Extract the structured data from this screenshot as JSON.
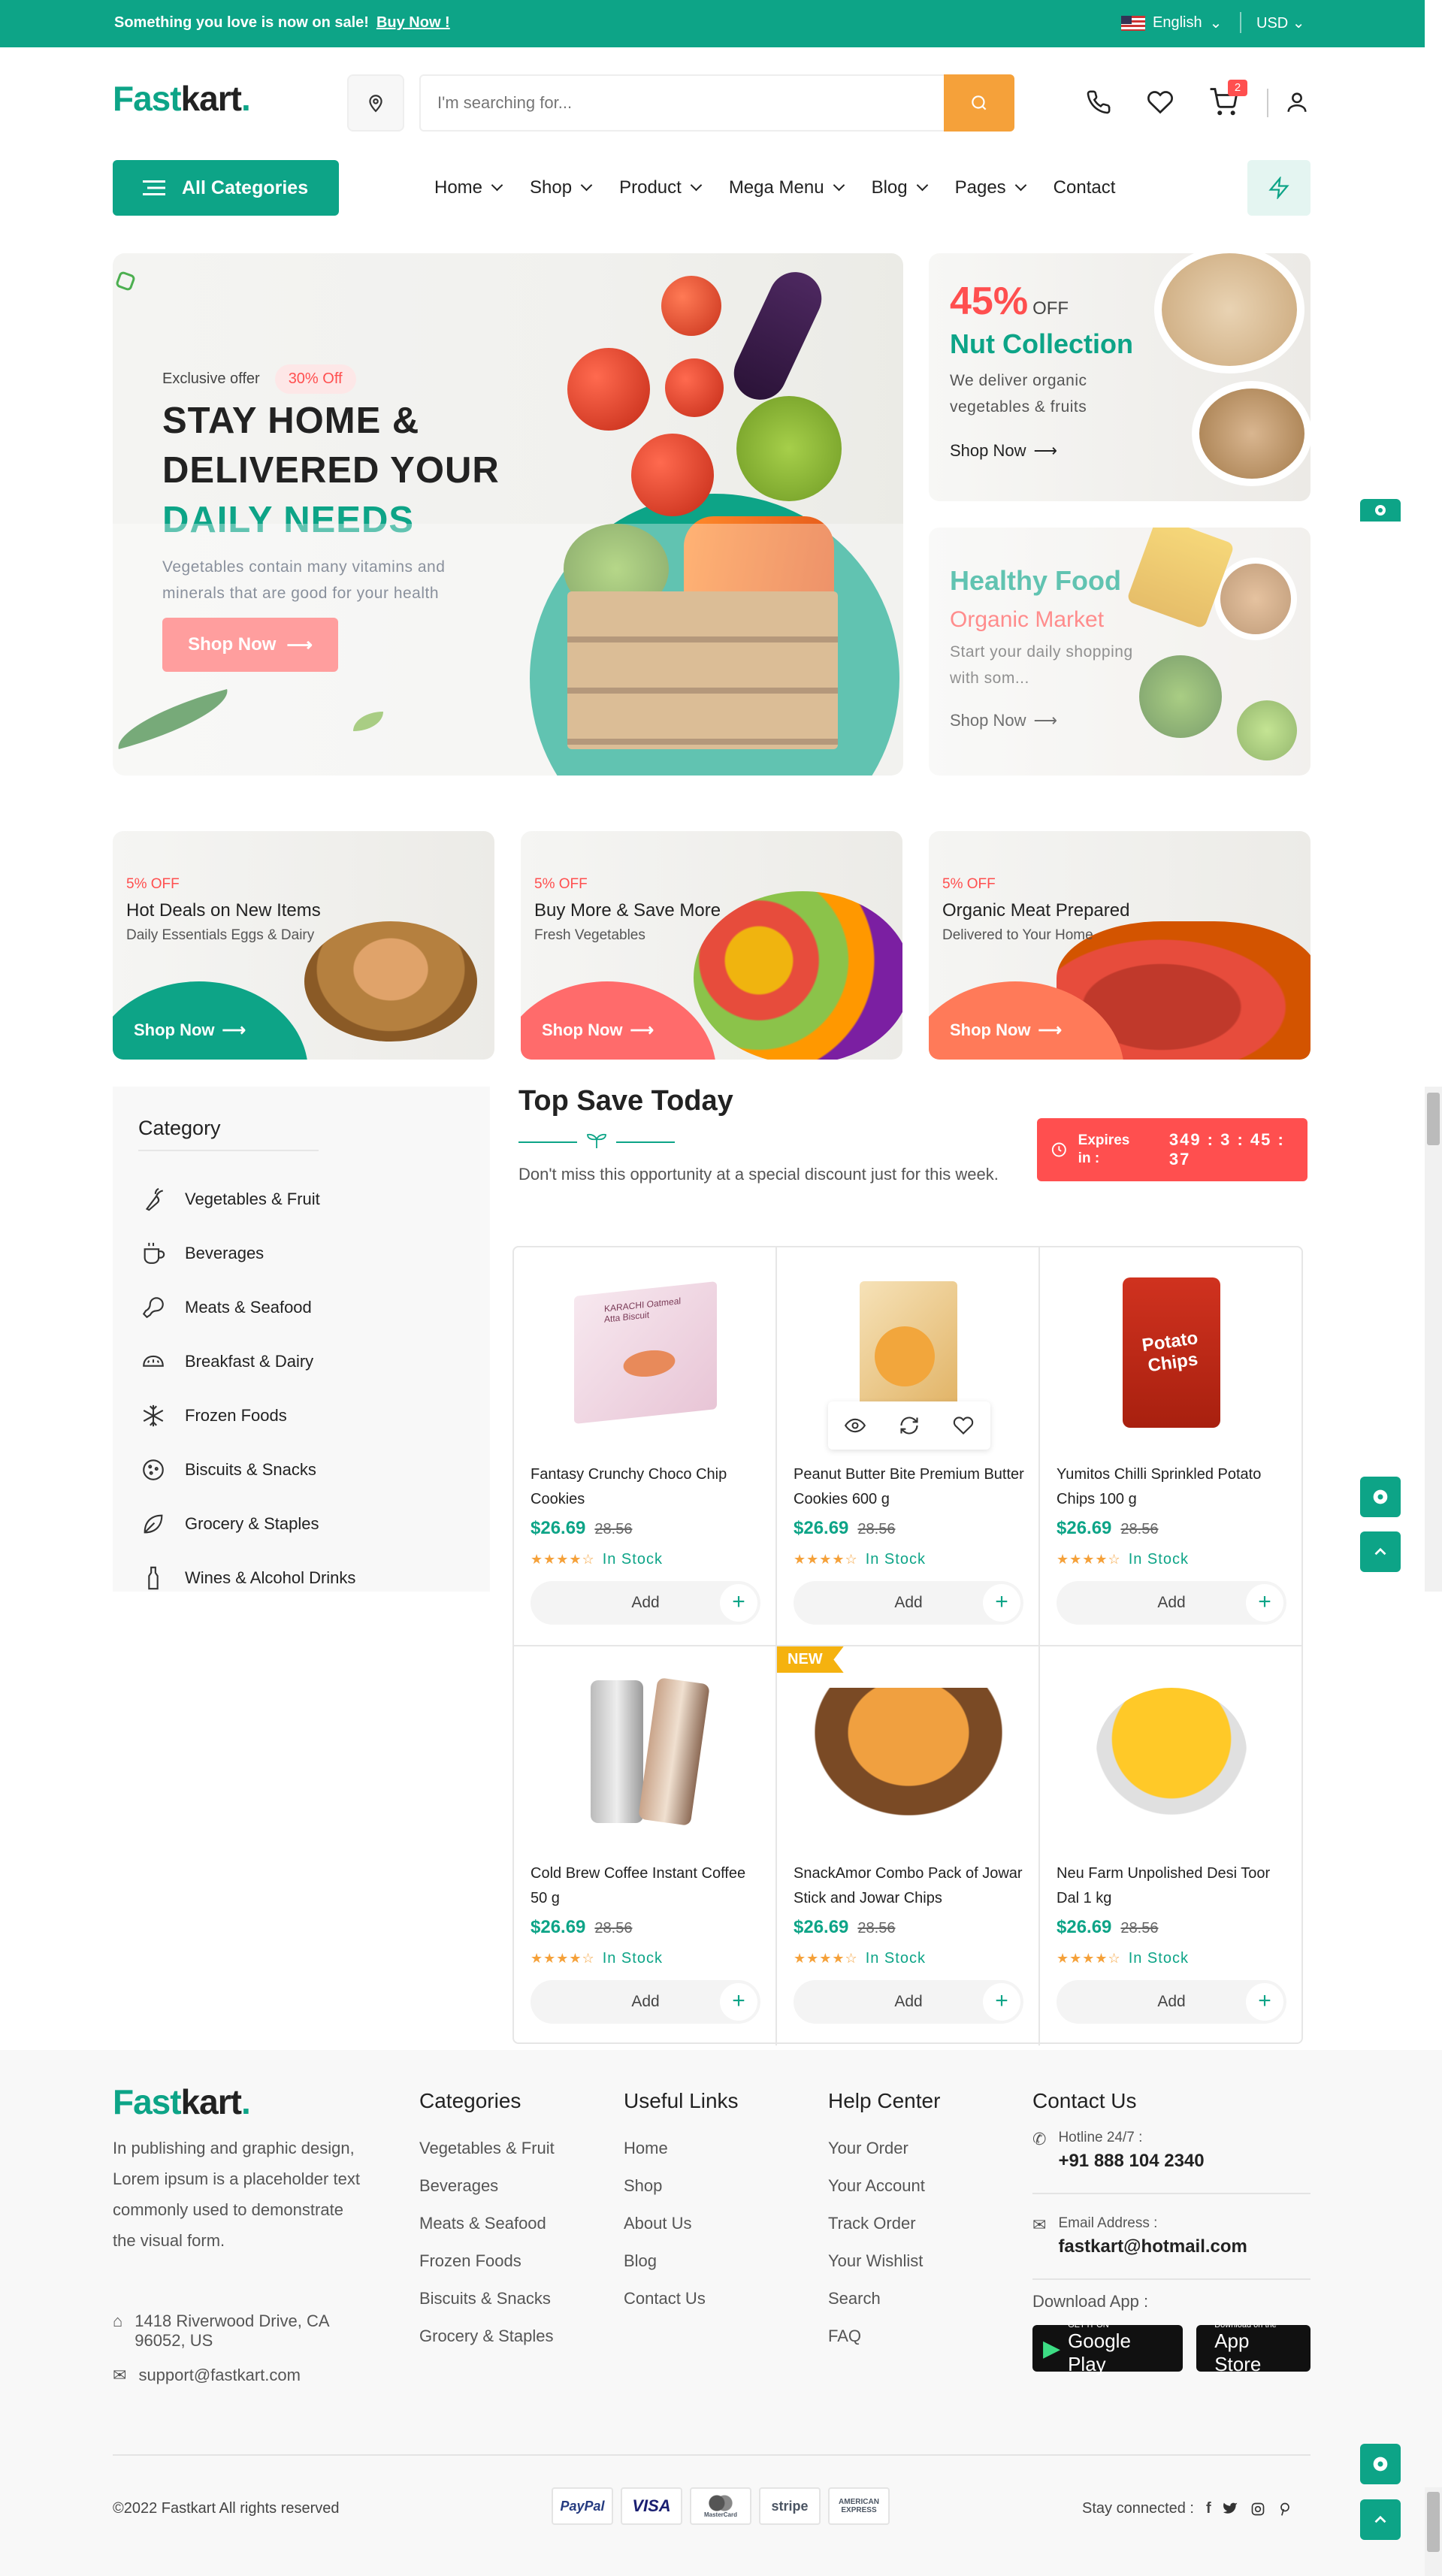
{
  "topbar": {
    "message": "Something you love is now on sale!",
    "link": "Buy Now !",
    "language": "English",
    "currency": "USD"
  },
  "header": {
    "logo_main": "Fast",
    "logo_accent": "kart",
    "logo_dot": ".",
    "search_placeholder": "I'm searching for...",
    "cart_count": "2"
  },
  "nav": {
    "all_categories": "All Categories",
    "items": [
      "Home",
      "Shop",
      "Product",
      "Mega Menu",
      "Blog",
      "Pages",
      "Contact"
    ]
  },
  "hero": {
    "exclusive": "Exclusive offer",
    "badge": "30% Off",
    "line1": "STAY HOME &",
    "line2": "DELIVERED YOUR",
    "line3": "DAILY NEEDS",
    "desc": "Vegetables contain many vitamins and minerals that are good for your health",
    "cta": "Shop Now"
  },
  "side_banners": [
    {
      "percent": "45%",
      "off": "OFF",
      "title": "Nut Collection",
      "desc": "We deliver organic vegetables & fruits",
      "cta": "Shop Now"
    },
    {
      "title": "Healthy Food",
      "subtitle": "Organic Market",
      "desc": "Start your daily shopping with som...",
      "cta": "Shop Now"
    }
  ],
  "small_banners": [
    {
      "pct": "5% OFF",
      "title": "Hot Deals on New Items",
      "sub": "Daily Essentials Eggs & Dairy",
      "cta": "Shop Now"
    },
    {
      "pct": "5% OFF",
      "title": "Buy More & Save More",
      "sub": "Fresh Vegetables",
      "cta": "Shop Now"
    },
    {
      "pct": "5% OFF",
      "title": "Organic Meat Prepared",
      "sub": "Delivered to Your Home",
      "cta": "Shop Now"
    }
  ],
  "sidebar": {
    "title": "Category",
    "items": [
      "Vegetables & Fruit",
      "Beverages",
      "Meats & Seafood",
      "Breakfast & Dairy",
      "Frozen Foods",
      "Biscuits & Snacks",
      "Grocery & Staples",
      "Wines & Alcohol Drinks"
    ]
  },
  "top_save": {
    "title": "Top Save Today",
    "desc": "Don't miss this opportunity at a special discount just for this week.",
    "expires_label": "Expires in :",
    "timer": "349 : 3 : 45 : 37"
  },
  "products": [
    {
      "name": "Fantasy Crunchy Choco Chip Cookies",
      "price": "$26.69",
      "old": "28.56",
      "stock": "In Stock",
      "add": "Add",
      "rating": 4
    },
    {
      "name": "Peanut Butter Bite Premium Butter Cookies 600 g",
      "price": "$26.69",
      "old": "28.56",
      "stock": "In Stock",
      "add": "Add",
      "rating": 4
    },
    {
      "name": "Yumitos Chilli Sprinkled Potato Chips 100 g",
      "price": "$26.69",
      "old": "28.56",
      "stock": "In Stock",
      "add": "Add",
      "rating": 4
    },
    {
      "name": "Cold Brew Coffee Instant Coffee 50 g",
      "price": "$26.69",
      "old": "28.56",
      "stock": "In Stock",
      "add": "Add",
      "rating": 4
    },
    {
      "name": "SnackAmor Combo Pack of Jowar Stick and Jowar Chips",
      "price": "$26.69",
      "old": "28.56",
      "stock": "In Stock",
      "add": "Add",
      "rating": 4,
      "tag": "NEW"
    },
    {
      "name": "Neu Farm Unpolished Desi Toor Dal 1 kg",
      "price": "$26.69",
      "old": "28.56",
      "stock": "In Stock",
      "add": "Add",
      "rating": 4
    }
  ],
  "product_image_labels": {
    "box": "KARACHI Oatmeal Atta Biscuit",
    "chips": "Potato Chips"
  },
  "footer": {
    "desc": "In publishing and graphic design, Lorem ipsum is a placeholder text commonly used to demonstrate the visual form.",
    "address": "1418 Riverwood Drive, CA 96052, US",
    "email": "support@fastkart.com",
    "categories_title": "Categories",
    "categories": [
      "Vegetables & Fruit",
      "Beverages",
      "Meats & Seafood",
      "Frozen Foods",
      "Biscuits & Snacks",
      "Grocery & Staples"
    ],
    "links_title": "Useful Links",
    "links": [
      "Home",
      "Shop",
      "About Us",
      "Blog",
      "Contact Us"
    ],
    "help_title": "Help Center",
    "help": [
      "Your Order",
      "Your Account",
      "Track Order",
      "Your Wishlist",
      "Search",
      "FAQ"
    ],
    "contact_title": "Contact Us",
    "hotline_label": "Hotline 24/7 :",
    "hotline": "+91 888 104 2340",
    "email_label": "Email Address :",
    "email2": "fastkart@hotmail.com",
    "download": "Download App :",
    "gp_small": "GET IT ON",
    "gp": "Google Play",
    "as_small": "Download on the",
    "as": "App Store",
    "copyright": "©2022 Fastkart All rights reserved",
    "payments": [
      "PayPal",
      "VISA",
      "MasterCard",
      "stripe",
      "AMERICAN EXPRESS"
    ],
    "stay": "Stay connected :"
  },
  "colors": {
    "brand": "#0da487",
    "accent": "#ff4f4f",
    "orange": "#f5a13a"
  }
}
